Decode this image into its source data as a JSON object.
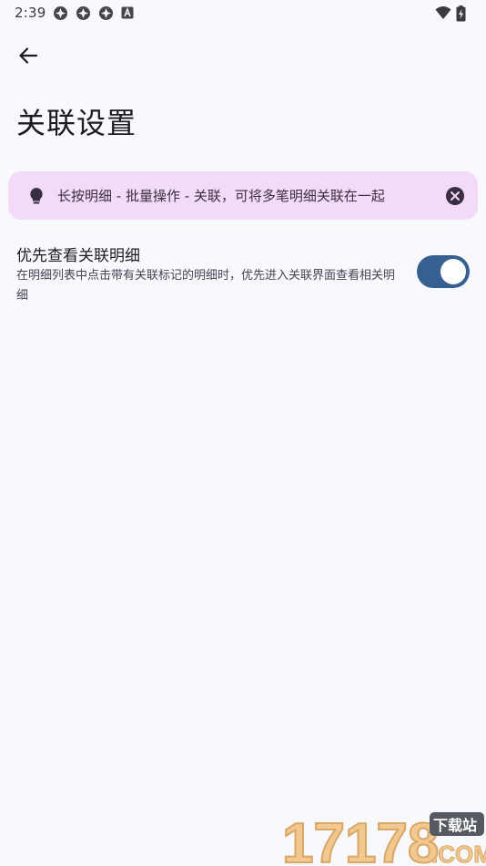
{
  "status_bar": {
    "time": "2:39",
    "notification_icons": [
      "app-notification-icon",
      "app-notification-icon",
      "app-notification-icon",
      "font-a-icon"
    ],
    "right_icons": [
      "wifi-icon",
      "battery-charging-icon"
    ]
  },
  "app_bar": {
    "back_icon": "arrow-left-icon",
    "title": "关联设置"
  },
  "tip": {
    "icon": "lightbulb-icon",
    "text": "长按明细 - 批量操作 - 关联，可将多笔明细关联在一起",
    "close_icon": "close-circle-icon",
    "colors": {
      "background": "#f3daf8"
    }
  },
  "settings": {
    "priority_linked": {
      "title": "优先查看关联明细",
      "description": "在明细列表中点击带有关联标记的明细时，优先进入关联界面查看相关明细",
      "enabled": true
    }
  },
  "watermark": {
    "brand": "17178",
    "tag": "下载站",
    "suffix": ".COM"
  },
  "colors": {
    "background": "#f8f9ff",
    "toggle_on": "#35608f",
    "text_primary": "#1b1b21"
  }
}
